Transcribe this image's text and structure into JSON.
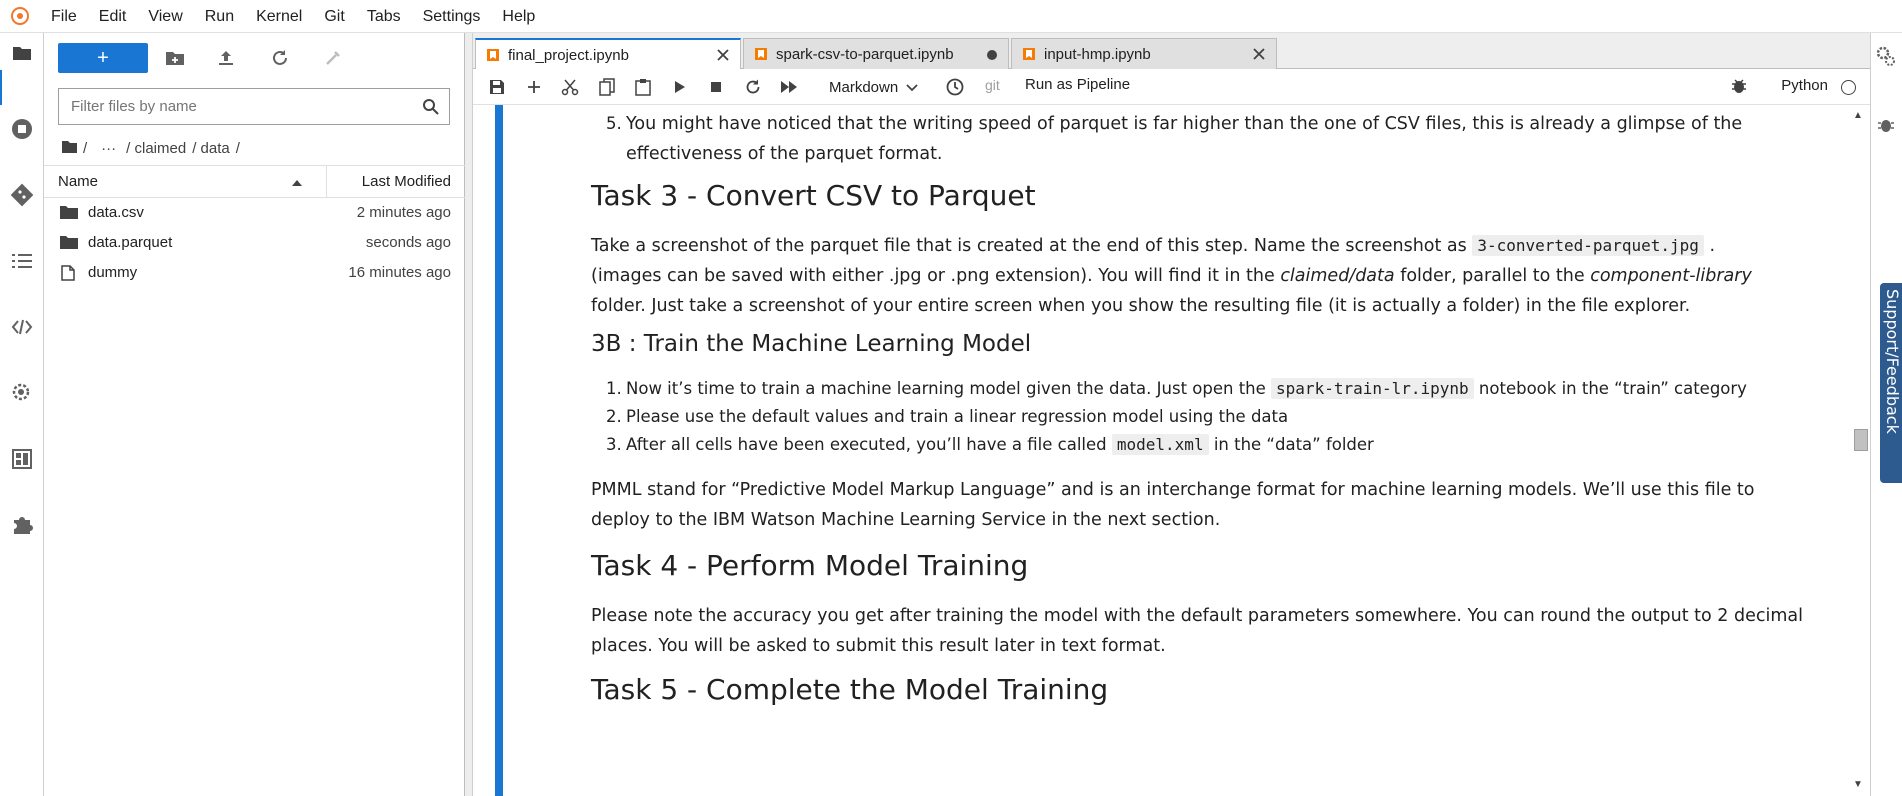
{
  "menu": [
    "File",
    "Edit",
    "View",
    "Run",
    "Kernel",
    "Git",
    "Tabs",
    "Settings",
    "Help"
  ],
  "filebrowser": {
    "new_label": "+",
    "filter_placeholder": "Filter files by name",
    "breadcrumb": [
      "/",
      "···",
      "/ claimed",
      "/ data",
      "/"
    ],
    "col_name": "Name",
    "col_modified": "Last Modified",
    "files": [
      {
        "name": "data.csv",
        "modified": "2 minutes ago",
        "type": "folder"
      },
      {
        "name": "data.parquet",
        "modified": "seconds ago",
        "type": "folder"
      },
      {
        "name": "dummy",
        "modified": "16 minutes ago",
        "type": "file"
      }
    ]
  },
  "tabs": [
    {
      "label": "final_project.ipynb",
      "active": true,
      "state": "close"
    },
    {
      "label": "spark-csv-to-parquet.ipynb",
      "active": false,
      "state": "dirty"
    },
    {
      "label": "input-hmp.ipynb",
      "active": false,
      "state": "close"
    }
  ],
  "toolbar": {
    "cell_type": "Markdown",
    "git_label": "git",
    "run_pipeline": "Run as Pipeline",
    "kernel": "Python"
  },
  "notebook": {
    "item5_num": "5.",
    "item5_text": "You might have noticed that the writing speed of parquet is far higher than the one of CSV files, this is already a glimpse of the effectiveness of the parquet format.",
    "task3_title": "Task 3 - Convert CSV to Parquet",
    "task3_p1_a": "Take a screenshot of the parquet file that is created at the end of this step. Name the screenshot as ",
    "task3_p1_code": "3-converted-parquet.jpg",
    "task3_p1_b": " .",
    "task3_p2_a": "(images can be saved with either .jpg or .png extension). You will find it in the ",
    "task3_p2_em1": "claimed/data",
    "task3_p2_b": " folder, parallel to the ",
    "task3_p2_em2": "component-library",
    "task3_p3": "folder. Just take a screenshot of your entire screen when you show the resulting file (it is actually a folder) in the file explorer.",
    "h3b_title": "3B : Train the Machine Learning Model",
    "list": [
      {
        "num": "1.",
        "a": "Now it’s time to train a machine learning model given the data. Just open the ",
        "code": "spark-train-lr.ipynb",
        "b": " notebook in the “train” category"
      },
      {
        "num": "2.",
        "a": "Please use the default values and train a linear regression model using the data",
        "code": "",
        "b": ""
      },
      {
        "num": "3.",
        "a": "After all cells have been executed, you’ll have a file called ",
        "code": "model.xml",
        "b": " in the “data” folder"
      }
    ],
    "pmml_p1": "PMML stand for “Predictive Model Markup Language” and is an interchange format for machine learning models. We’ll use this file to",
    "pmml_p2": "deploy to the IBM Watson Machine Learning Service in the next section.",
    "task4_title": "Task 4 - Perform Model Training",
    "task4_p1": "Please note the accuracy you get after training the model with the default parameters somewhere. You can round the output to 2 decimal",
    "task4_p2": "places. You will be asked to submit this result later in text format.",
    "task5_title": "Task 5 - Complete the Model Training"
  },
  "feedback": {
    "label": "Support/Feedback"
  },
  "colors": {
    "accent": "#1976d2",
    "notebook_icon": "#f57c00",
    "feedback": "#2d5b8f"
  }
}
